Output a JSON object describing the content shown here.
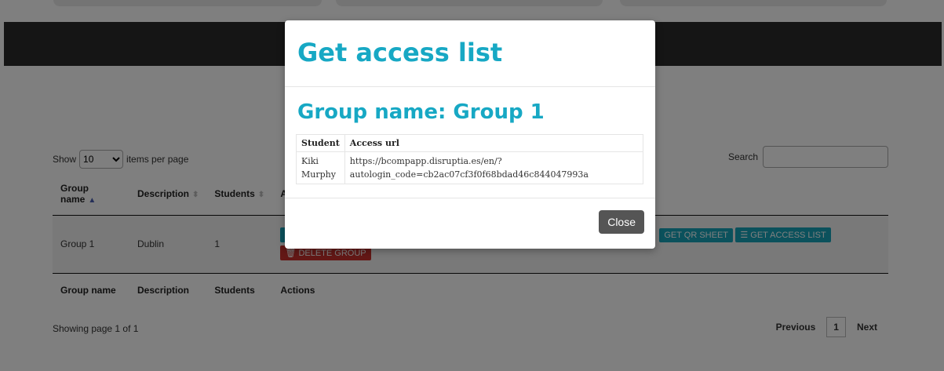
{
  "controls": {
    "show_label": "Show",
    "page_size": "10",
    "items_per_page_label": "items per page",
    "search_label": "Search",
    "search_value": ""
  },
  "table": {
    "headers": [
      "Group name",
      "Description",
      "Students",
      "Actions"
    ],
    "rows": [
      {
        "group_name": "Group 1",
        "description": "Dublin",
        "students": "1",
        "actions": {
          "edit": "",
          "get_qr_sheet": "GET QR SHEET",
          "get_access_list": "GET ACCESS LIST",
          "delete_group": "DELETE GROUP"
        }
      }
    ]
  },
  "footer": {
    "info": "Showing page 1 of 1",
    "previous": "Previous",
    "page": "1",
    "next": "Next"
  },
  "modal": {
    "title": "Get access list",
    "group_title": "Group name: Group 1",
    "columns": [
      "Student",
      "Access url"
    ],
    "entries": [
      {
        "student_line1": "Kiki",
        "student_line2": "Murphy",
        "url_line1": "https://bcompapp.disruptia.es/en/?",
        "url_line2": "autologin_code=cb2ac07cf3f0f68bdad46c844047993a"
      }
    ],
    "close_label": "Close"
  },
  "colors": {
    "accent": "#17a8c4",
    "danger": "#c9302c",
    "overlay": "rgba(0,0,0,0.5)"
  },
  "icons": [
    "sort-asc-icon",
    "sort-icon",
    "edit-icon",
    "list-icon",
    "trash-icon",
    "chevron-down-icon"
  ]
}
